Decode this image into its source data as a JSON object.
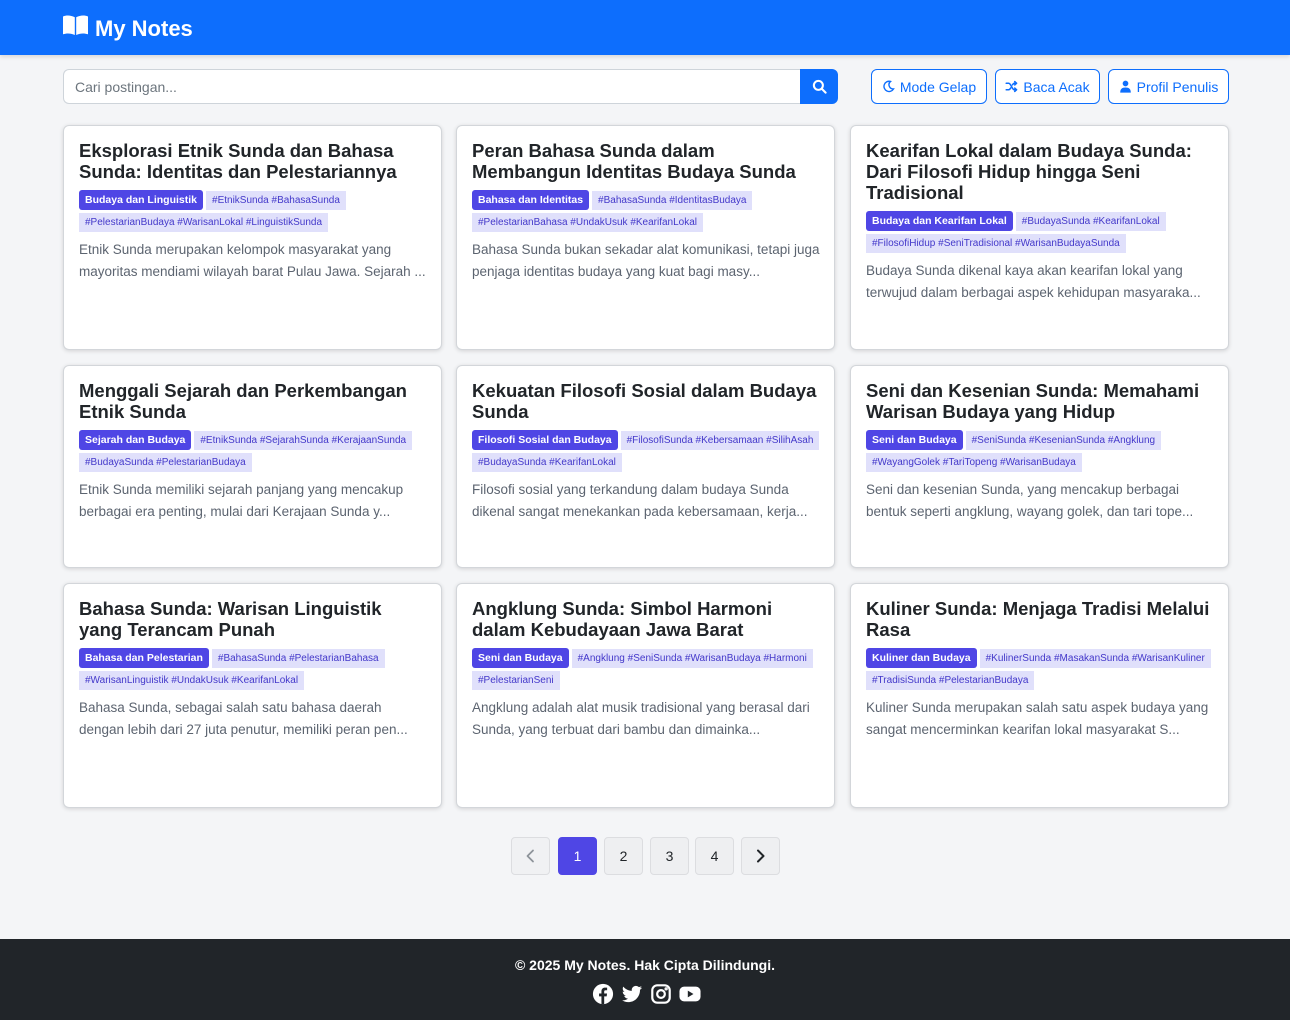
{
  "header": {
    "brand": "My Notes",
    "brand_icon": "book-open-icon",
    "background": "#0d6efd"
  },
  "search": {
    "placeholder": "Cari postingan...",
    "value": "",
    "button_icon": "search-icon"
  },
  "toolbar": {
    "dark_mode_label": "Mode Gelap",
    "random_read_label": "Baca Acak",
    "author_profile_label": "Profil Penulis"
  },
  "posts": [
    {
      "title": "Eksplorasi Etnik Sunda dan Bahasa Sunda: Identitas dan Pelestariannya",
      "category": "Budaya dan Linguistik",
      "tags": "#EtnikSunda #BahasaSunda #PelestarianBudaya #WarisanLokal #LinguistikSunda",
      "excerpt": "Etnik Sunda merupakan kelompok masyarakat yang mayoritas mendiami wilayah barat Pulau Jawa. Sejarah ..."
    },
    {
      "title": "Peran Bahasa Sunda dalam Membangun Identitas Budaya Sunda",
      "category": "Bahasa dan Identitas",
      "tags": "#BahasaSunda #IdentitasBudaya #PelestarianBahasa #UndakUsuk #KearifanLokal",
      "excerpt": "Bahasa Sunda bukan sekadar alat komunikasi, tetapi juga penjaga identitas budaya yang kuat bagi masy..."
    },
    {
      "title": "Kearifan Lokal dalam Budaya Sunda: Dari Filosofi Hidup hingga Seni Tradisional",
      "category": "Budaya dan Kearifan Lokal",
      "tags": "#BudayaSunda #KearifanLokal #FilosofiHidup #SeniTradisional #WarisanBudayaSunda",
      "excerpt": "Budaya Sunda dikenal kaya akan kearifan lokal yang terwujud dalam berbagai aspek kehidupan masyaraka..."
    },
    {
      "title": "Menggali Sejarah dan Perkembangan Etnik Sunda",
      "category": "Sejarah dan Budaya",
      "tags": "#EtnikSunda #SejarahSunda #KerajaanSunda #BudayaSunda #PelestarianBudaya",
      "excerpt": "Etnik Sunda memiliki sejarah panjang yang mencakup berbagai era penting, mulai dari Kerajaan Sunda y..."
    },
    {
      "title": "Kekuatan Filosofi Sosial dalam Budaya Sunda",
      "category": "Filosofi Sosial dan Budaya",
      "tags": "#FilosofiSunda #Kebersamaan #SilihAsah #BudayaSunda #KearifanLokal",
      "excerpt": "Filosofi sosial yang terkandung dalam budaya Sunda dikenal sangat menekankan pada kebersamaan, kerja..."
    },
    {
      "title": "Seni dan Kesenian Sunda: Memahami Warisan Budaya yang Hidup",
      "category": "Seni dan Budaya",
      "tags": "#SeniSunda #KesenianSunda #Angklung #WayangGolek #TariTopeng #WarisanBudaya",
      "excerpt": "Seni dan kesenian Sunda, yang mencakup berbagai bentuk seperti angklung, wayang golek, dan tari tope..."
    },
    {
      "title": "Bahasa Sunda: Warisan Linguistik yang Terancam Punah",
      "category": "Bahasa dan Pelestarian",
      "tags": "#BahasaSunda #PelestarianBahasa #WarisanLinguistik #UndakUsuk #KearifanLokal",
      "excerpt": "Bahasa Sunda, sebagai salah satu bahasa daerah dengan lebih dari 27 juta penutur, memiliki peran pen..."
    },
    {
      "title": "Angklung Sunda: Simbol Harmoni dalam Kebudayaan Jawa Barat",
      "category": "Seni dan Budaya",
      "tags": "#Angklung #SeniSunda #WarisanBudaya #Harmoni #PelestarianSeni",
      "excerpt": "Angklung adalah alat musik tradisional yang berasal dari Sunda, yang terbuat dari bambu dan dimainka..."
    },
    {
      "title": "Kuliner Sunda: Menjaga Tradisi Melalui Rasa",
      "category": "Kuliner dan Budaya",
      "tags": "#KulinerSunda #MasakanSunda #WarisanKuliner #TradisiSunda #PelestarianBudaya",
      "excerpt": "Kuliner Sunda merupakan salah satu aspek budaya yang sangat mencerminkan kearifan lokal masyarakat S..."
    }
  ],
  "pagination": {
    "pages": [
      "1",
      "2",
      "3",
      "4"
    ],
    "current": "1",
    "prev_icon": "chevron-left-icon",
    "next_icon": "chevron-right-icon"
  },
  "footer": {
    "copyright": "© 2025 My Notes. Hak Cipta Dilindungi.",
    "socials": [
      "facebook-icon",
      "twitter-icon",
      "instagram-icon",
      "youtube-icon"
    ]
  },
  "colors": {
    "primary": "#0d6efd",
    "badge": "#4f46e5",
    "tag_bg": "#e0e0fb",
    "tag_text": "#4338ca",
    "footer": "#212529"
  }
}
